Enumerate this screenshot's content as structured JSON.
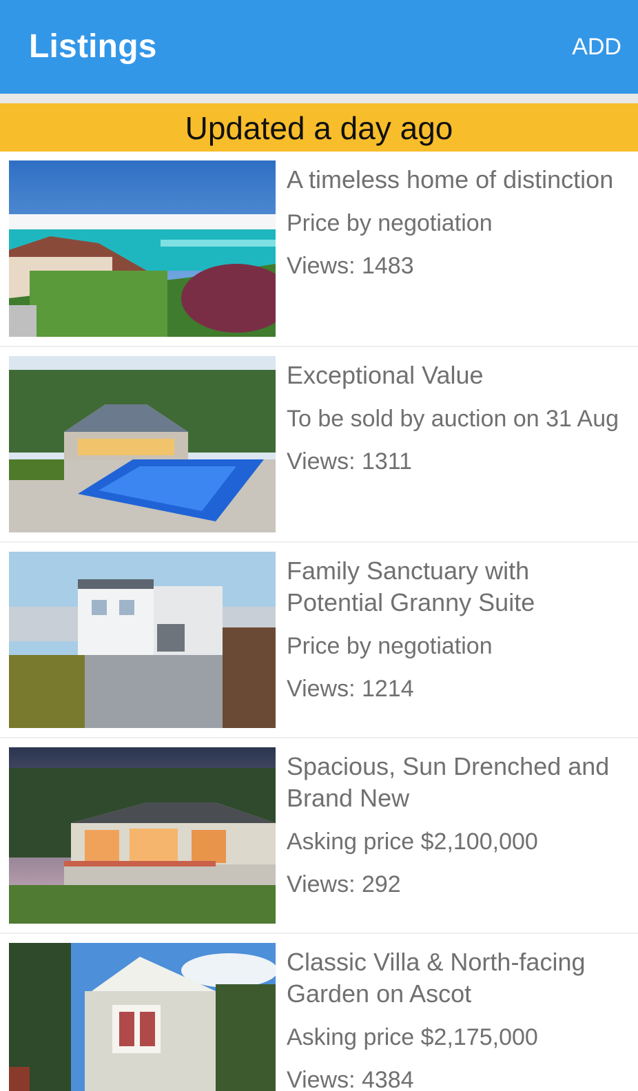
{
  "appbar": {
    "title": "Listings",
    "add_label": "ADD"
  },
  "banner": {
    "text": "Updated a day ago"
  },
  "listings": [
    {
      "title": "A timeless home of distinction",
      "price": "Price by negotiation",
      "views": "Views: 1483"
    },
    {
      "title": "Exceptional Value",
      "price": "To be sold by auction on 31 Aug",
      "views": "Views: 1311"
    },
    {
      "title": "Family Sanctuary with Potential Granny Suite",
      "price": "Price by negotiation",
      "views": "Views: 1214"
    },
    {
      "title": "Spacious, Sun Drenched and Brand New",
      "price": "Asking price $2,100,000",
      "views": "Views: 292"
    },
    {
      "title": "Classic Villa & North-facing Garden on Ascot",
      "price": "Asking price $2,175,000",
      "views": "Views: 4384"
    }
  ],
  "colors": {
    "appbar": "#3397e8",
    "banner": "#f8bd2a",
    "text_secondary": "#707070"
  }
}
